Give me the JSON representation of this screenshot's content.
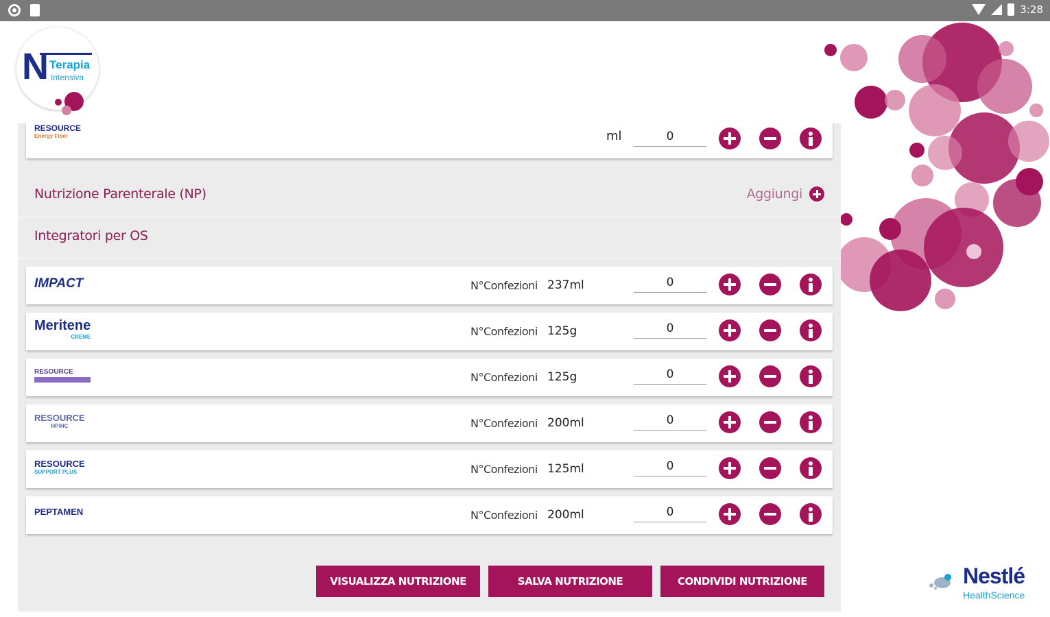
{
  "status_bar": {
    "time": "3:28"
  },
  "app_logo": {
    "letter": "N",
    "line1": "Terapia",
    "line2": "Intensiva"
  },
  "top_product": {
    "brand": "RESOURCE",
    "brand_sub": "Energy Fiber",
    "unit": "ml",
    "quantity": "0"
  },
  "sections": {
    "parenteral": {
      "title": "Nutrizione Parenterale (NP)",
      "add_label": "Aggiungi"
    },
    "oral": {
      "title": "Integratori per OS"
    }
  },
  "products": [
    {
      "brand": "IMPACT",
      "brand_sub": "",
      "label": "N°Confezioni",
      "size": "237ml",
      "quantity": "0"
    },
    {
      "brand": "Meritene",
      "brand_sub": "CREME",
      "label": "N°Confezioni",
      "size": "125g",
      "quantity": "0"
    },
    {
      "brand": "RESOURCE",
      "brand_sub": "",
      "label": "N°Confezioni",
      "size": "125g",
      "quantity": "0"
    },
    {
      "brand": "RESOURCE",
      "brand_sub": "HP/HC",
      "label": "N°Confezioni",
      "size": "200ml",
      "quantity": "0"
    },
    {
      "brand": "RESOURCE",
      "brand_sub": "SUPPORT PLUS",
      "label": "N°Confezioni",
      "size": "125ml",
      "quantity": "0"
    },
    {
      "brand": "PEPTAMEN",
      "brand_sub": "",
      "label": "N°Confezioni",
      "size": "200ml",
      "quantity": "0"
    }
  ],
  "actions": {
    "view": "VISUALIZZA NUTRIZIONE",
    "save": "SALVA NUTRIZIONE",
    "share": "CONDIVIDI NUTRIZIONE"
  },
  "footer_logo": {
    "word": "Nestlé",
    "sub": "HealthScience"
  },
  "colors": {
    "accent": "#a4145a",
    "accent_light": "#d77ea4",
    "brand_blue": "#1d2d8a",
    "panel": "#ececec"
  },
  "icons": {
    "add": "plus-circle-icon",
    "remove": "minus-circle-icon",
    "info": "info-circle-icon"
  }
}
